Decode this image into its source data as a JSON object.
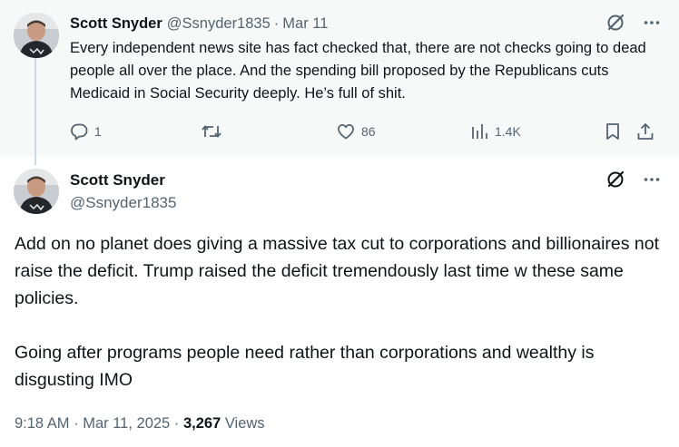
{
  "parent_tweet": {
    "author_name": "Scott Snyder",
    "handle": "@Ssnyder1835",
    "separator": "·",
    "date": "Mar 11",
    "text": "Every independent news site has fact checked that, there are not checks going to dead people all over the place. And the spending bill proposed by the Republicans cuts Medicaid in Social Security deeply. He’s full of shit.",
    "replies": "1",
    "retweets": "",
    "likes": "86",
    "views": "1.4K"
  },
  "main_tweet": {
    "author_name": "Scott Snyder",
    "handle": "@Ssnyder1835",
    "text": "Add on no planet does giving a massive tax cut to corporations and billionaires not raise the deficit. Trump raised the deficit tremendously last time w these same policies.\n\nGoing after programs people need rather than corporations and wealthy is disgusting IMO",
    "time": "9:18 AM",
    "separator": "·",
    "date": "Mar 11, 2025",
    "views_count": "3,267",
    "views_label": "Views"
  },
  "icons": {
    "reply": "reply-icon",
    "retweet": "retweet-icon",
    "like": "heart-icon",
    "views": "analytics-icon",
    "bookmark": "bookmark-icon",
    "share": "share-icon",
    "grok": "grok-icon",
    "more": "more-icon"
  },
  "colors": {
    "text_primary": "#0f1419",
    "text_secondary": "#536471",
    "parent_background": "#f7f9f9",
    "thread_line": "#cfd9de"
  }
}
